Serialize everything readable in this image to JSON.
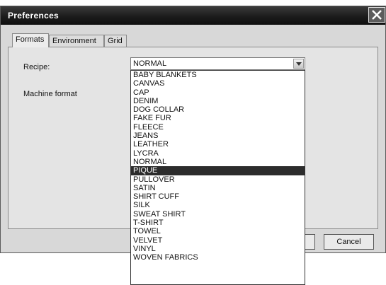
{
  "window": {
    "title": "Preferences"
  },
  "tabs": [
    {
      "label": "Formats",
      "active": true
    },
    {
      "label": "Environment",
      "active": false
    },
    {
      "label": "Grid",
      "active": false
    }
  ],
  "form": {
    "recipe_label": "Recipe:",
    "machine_format_label": "Machine format"
  },
  "recipe": {
    "selected": "NORMAL",
    "highlighted": "PIQUE",
    "options": [
      "BABY BLANKETS",
      "CANVAS",
      "CAP",
      "DENIM",
      "DOG COLLAR",
      "FAKE FUR",
      "FLEECE",
      "JEANS",
      "LEATHER",
      "LYCRA",
      "NORMAL",
      "PIQUE",
      "PULLOVER",
      "SATIN",
      "SHIRT CUFF",
      "SILK",
      "SWEAT SHIRT",
      "T-SHIRT",
      "TOWEL",
      "VELVET",
      "VINYL",
      "WOVEN FABRICS"
    ]
  },
  "buttons": {
    "cancel_label": "Cancel"
  },
  "icons": {
    "close": "close-icon",
    "dropdown": "chevron-down-icon"
  },
  "colors": {
    "titlebar": "#1a1a1a",
    "highlight": "#2c2c2c"
  }
}
